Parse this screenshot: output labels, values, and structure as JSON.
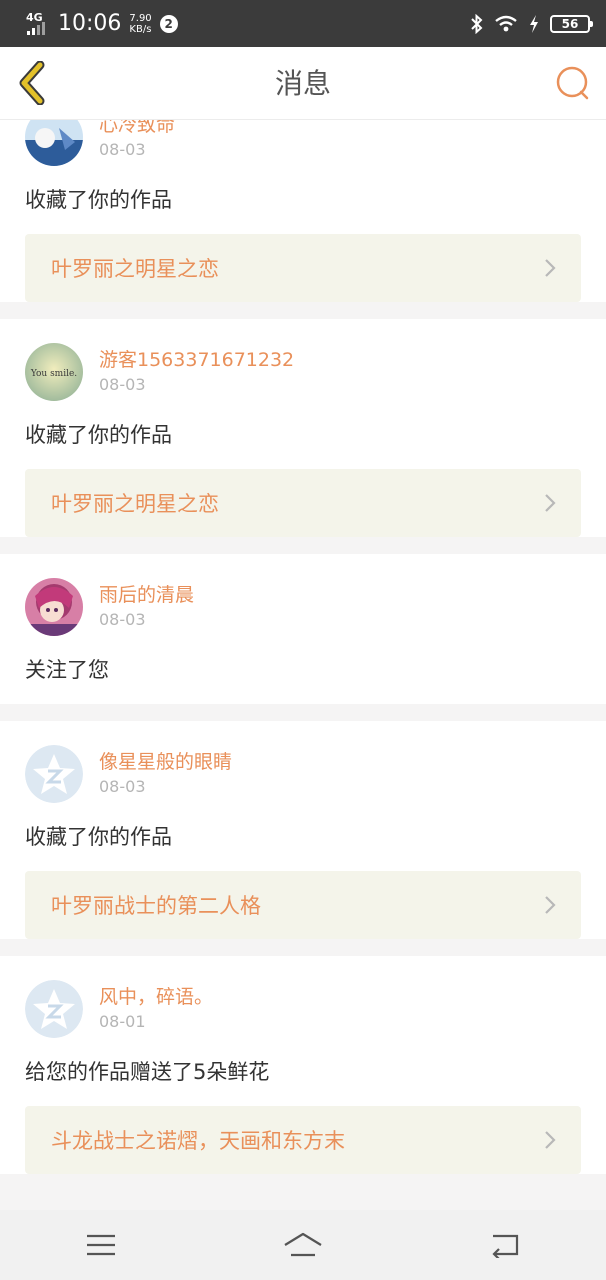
{
  "status_bar": {
    "network": "4G",
    "time": "10:06",
    "speed_value": "7.90",
    "speed_unit": "KB/s",
    "notification_count": "2",
    "battery": "56"
  },
  "header": {
    "title": "消息",
    "back_icon": "back-chevron-icon",
    "search_icon": "search-icon"
  },
  "messages": [
    {
      "username": "心冷致命",
      "date": "08-03",
      "action": "收藏了你的作品",
      "work": "叶罗丽之明星之恋",
      "avatar_icon": "anime-avatar"
    },
    {
      "username": "游客1563371671232",
      "date": "08-03",
      "action": "收藏了你的作品",
      "work": "叶罗丽之明星之恋",
      "avatar_icon": "you-smile-avatar",
      "avatar_text": "You smile."
    },
    {
      "username": "雨后的清晨",
      "date": "08-03",
      "action": "关注了您",
      "work": "",
      "avatar_icon": "anime-girl-avatar"
    },
    {
      "username": "像星星般的眼睛",
      "date": "08-03",
      "action": "收藏了你的作品",
      "work": "叶罗丽战士的第二人格",
      "avatar_icon": "default-star-avatar"
    },
    {
      "username": "风中，碎语。",
      "date": "08-01",
      "action": "给您的作品赠送了5朵鲜花",
      "work": "斗龙战士之诺熠，天画和东方末",
      "avatar_icon": "default-star-avatar"
    }
  ],
  "colors": {
    "accent": "#e9905a",
    "back_icon": "#c9a21a",
    "link_bg": "#f4f4ea"
  },
  "nav": {
    "menu_icon": "menu-icon",
    "home_icon": "home-icon",
    "back_icon": "back-icon"
  }
}
